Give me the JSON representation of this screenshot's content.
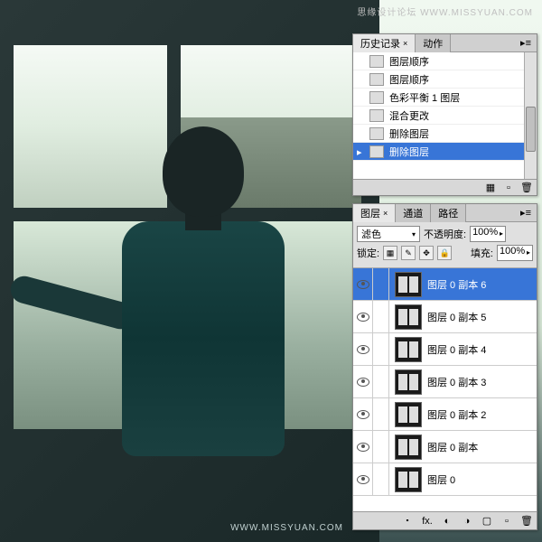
{
  "watermark_top": "思缘设计论坛 WWW.MISSYUAN.COM",
  "watermark_bottom": "WWW.MISSYUAN.COM",
  "history": {
    "tab_active": "历史记录",
    "tab_inactive": "动作",
    "items": [
      {
        "label": "图层顺序"
      },
      {
        "label": "图层顺序"
      },
      {
        "label": "色彩平衡 1 图层"
      },
      {
        "label": "混合更改"
      },
      {
        "label": "删除图层"
      },
      {
        "label": "删除图层",
        "selected": true,
        "marker": true
      }
    ]
  },
  "layers": {
    "tab1": "图层",
    "tab2": "通道",
    "tab3": "路径",
    "blend_mode": "滤色",
    "opacity_label": "不透明度:",
    "opacity_value": "100%",
    "lock_label": "锁定:",
    "fill_label": "填充:",
    "fill_value": "100%",
    "items": [
      {
        "name": "图层 0 副本 6",
        "selected": true
      },
      {
        "name": "图层 0 副本 5"
      },
      {
        "name": "图层 0 副本 4"
      },
      {
        "name": "图层 0 副本 3"
      },
      {
        "name": "图层 0 副本 2"
      },
      {
        "name": "图层 0 副本"
      },
      {
        "name": "图层 0"
      }
    ]
  }
}
